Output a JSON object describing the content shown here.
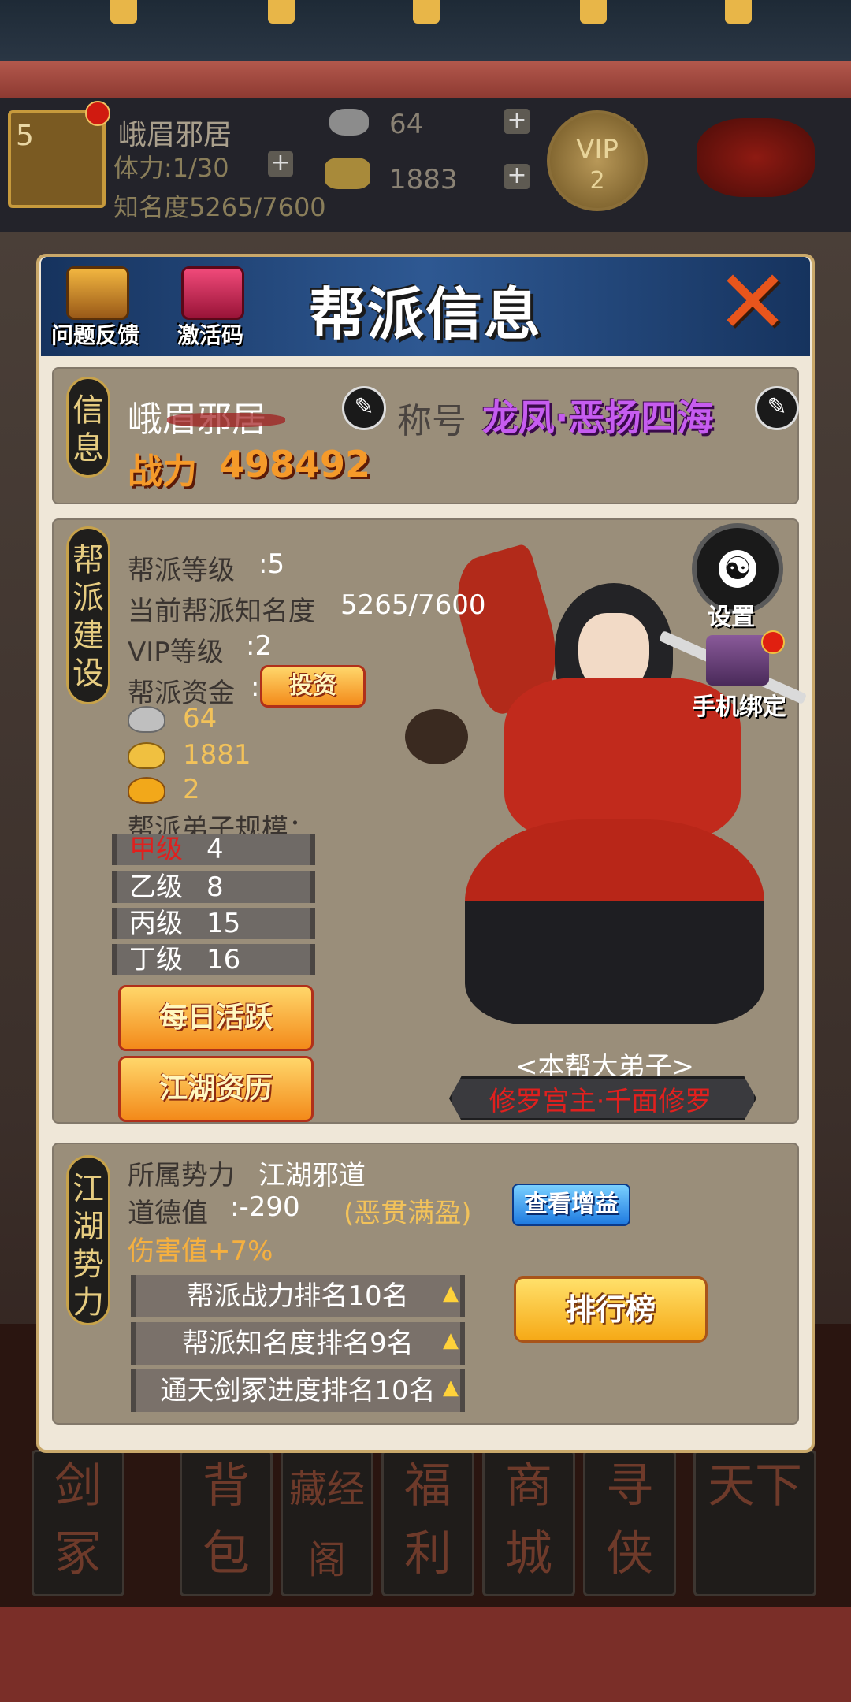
{
  "topbar": {
    "gang_level": "5",
    "gang_name": "峨眉邪居",
    "stamina": "体力:1/30",
    "fame": "知名度5265/7600",
    "silver": "64",
    "gold": "1883",
    "vip_label": "VIP",
    "vip_level": "2"
  },
  "panel": {
    "title": "帮派信息",
    "feedback_label": "问题反馈",
    "activation_label": "激活码"
  },
  "info": {
    "tag": "信息",
    "name": "峨眉邪居",
    "title_label": "称号",
    "title_value": "龙凤·恶扬四海",
    "power_label": "战力",
    "power_value": "498492"
  },
  "build": {
    "tag": "帮派建设",
    "level_label": "帮派等级",
    "level_value": ":5",
    "fame_label": "当前帮派知名度",
    "fame_value": "5265/7600",
    "vip_label": "VIP等级",
    "vip_value": ":2",
    "funds_label": "帮派资金",
    "funds_colon": ":",
    "invest_button": "投资",
    "silver": "64",
    "gold": "1881",
    "ingot": "2",
    "disciples_label": "帮派弟子规模：",
    "grades": [
      {
        "grade": "甲级",
        "count": "4",
        "color": "#e0201e"
      },
      {
        "grade": "乙级",
        "count": "8",
        "color": "#ffffff"
      },
      {
        "grade": "丙级",
        "count": "15",
        "color": "#ffffff"
      },
      {
        "grade": "丁级",
        "count": "16",
        "color": "#ffffff"
      }
    ],
    "daily_button": "每日活跃",
    "history_button": "江湖资历",
    "settings_label": "设置",
    "phone_label": "手机绑定",
    "disciple_caption": "<本帮大弟子>",
    "disciple_name": "修罗宫主·千面修罗"
  },
  "force": {
    "tag": "江湖势力",
    "faction_label": "所属势力",
    "faction_value": "江湖邪道",
    "morality_label": "道德值",
    "morality_value": ":-290",
    "morality_status": "(恶贯满盈)",
    "view_bonus_button": "查看增益",
    "damage": "伤害值+7%",
    "ranks": [
      "帮派战力排名10名",
      "帮派知名度排名9名",
      "通天剑冢进度排名10名"
    ],
    "leaderboard_button": "排行榜"
  },
  "bottom_nav": [
    "剑冢",
    "背包",
    "藏经阁",
    "福利",
    "商城",
    "寻侠",
    "天下"
  ],
  "colors": {
    "header_blue": "#2e5892",
    "title_purple": "#c65cf0",
    "power_orange": "#f59a2a",
    "disciple_red": "#e0201e"
  }
}
